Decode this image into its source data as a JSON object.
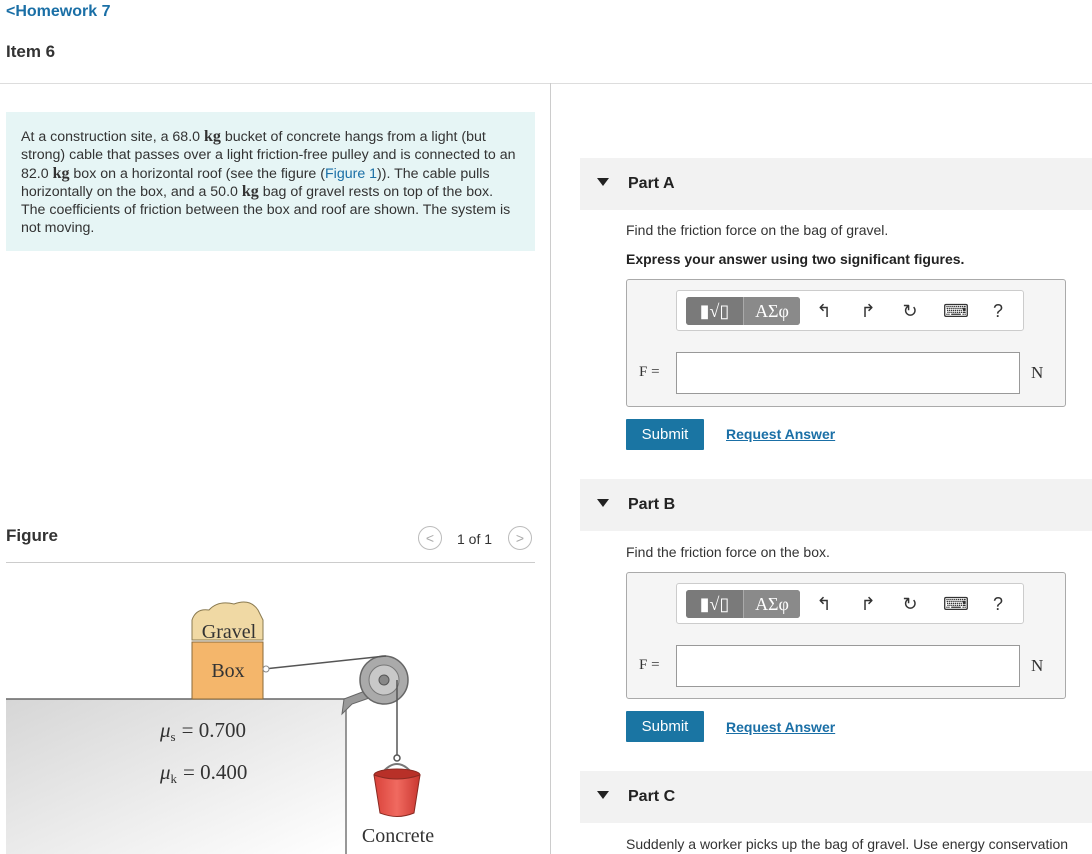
{
  "header": {
    "back_label": "<Homework 7",
    "item_title": "Item 6"
  },
  "problem": {
    "t1": "At a construction site, a 68.0 ",
    "unit": "kg",
    "t2": " bucket of concrete hangs from a light (but strong) cable that passes over a light friction-free pulley and is connected to an 82.0 ",
    "t3": " box on a horizontal roof (see the figure (",
    "figure_link": "Figure 1",
    "t4": ")). The cable pulls horizontally on the box, and a 50.0 ",
    "t5": " bag of gravel rests on top of the box. The coefficients of friction between the box and roof are shown. The system is not moving."
  },
  "figure": {
    "title": "Figure",
    "pager": "1 of 1",
    "prev_glyph": "<",
    "next_glyph": ">",
    "gravel_label": "Gravel",
    "box_label": "Box",
    "mu_s_symbol": "μ",
    "mu_s_sub": "s",
    "mu_s_value": "= 0.700",
    "mu_k_symbol": "μ",
    "mu_k_sub": "k",
    "mu_k_value": "= 0.400",
    "concrete_label": "Concrete"
  },
  "parts": {
    "a": {
      "title": "Part A",
      "question": "Find the friction force on the bag of gravel.",
      "instruction": "Express your answer using two significant figures.",
      "var": "F =",
      "unit": "N",
      "answer_value": "",
      "submit": "Submit",
      "request": "Request Answer"
    },
    "b": {
      "title": "Part B",
      "question": "Find the friction force on the box.",
      "var": "F =",
      "unit": "N",
      "answer_value": "",
      "submit": "Submit",
      "request": "Request Answer"
    },
    "c": {
      "title": "Part C",
      "question": "Suddenly a worker picks up the bag of gravel. Use energy conservation"
    }
  },
  "toolbar": {
    "template_glyph": "▮√▯",
    "greek_glyph": "ΑΣφ",
    "undo_glyph": "↰",
    "redo_glyph": "↱",
    "reset_glyph": "↻",
    "keyboard_glyph": "⌨",
    "help_glyph": "?"
  },
  "colors": {
    "link": "#1a6fa6",
    "submit_bg": "#1a75a3",
    "problem_bg": "#e6f5f5",
    "box_fill": "#f4b66b",
    "gravel_fill": "#f0d9a4",
    "bucket_fill": "#e8534b"
  }
}
